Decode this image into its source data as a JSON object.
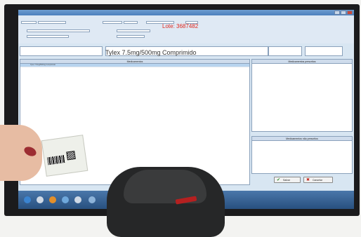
{
  "screen": {
    "lote_label": "Lote: 3687482",
    "product_text": "Tylex 7.5mg/500mg Comprimido"
  },
  "panels": {
    "left_title": "Medicamentos",
    "left_row": "Tylex 7.5mg/500mg Comprimido",
    "right_top_title": "Medicamentos prescritos",
    "right_bottom_title": "Medicamentos não prescritos"
  },
  "buttons": {
    "save_label": "Salvar",
    "cancel_label": "Cancelar"
  },
  "colors": {
    "accent_red": "#e0281e",
    "taskbar_blue": "#28507f"
  }
}
